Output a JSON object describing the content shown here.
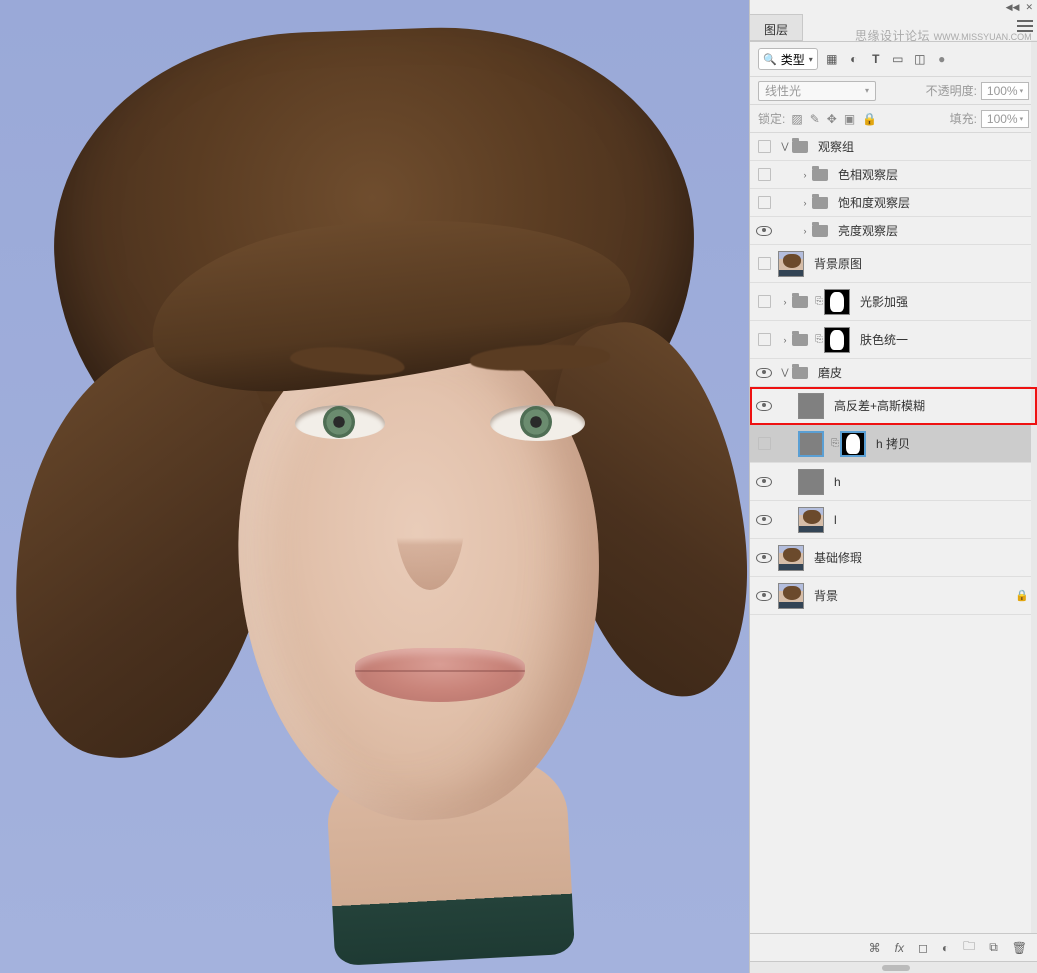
{
  "watermark": {
    "cn": "思缘设计论坛",
    "en": "WWW.MISSYUAN.COM"
  },
  "panelTop": {
    "collapse": "◀◀",
    "close": "✕"
  },
  "tabs": {
    "layers": "图层"
  },
  "filter": {
    "typeLabel": "类型"
  },
  "blend": {
    "mode": "线性光",
    "opacityLabel": "不透明度:",
    "opacityVal": "100%"
  },
  "lock": {
    "label": "锁定:",
    "fillLabel": "填充:",
    "fillVal": "100%"
  },
  "layers": [
    {
      "id": "g-observe",
      "name": "观察组"
    },
    {
      "id": "g-hue",
      "name": "色相观察层"
    },
    {
      "id": "g-sat",
      "name": "饱和度观察层"
    },
    {
      "id": "g-lum",
      "name": "亮度观察层"
    },
    {
      "id": "bg-orig",
      "name": "背景原图"
    },
    {
      "id": "g-light",
      "name": "光影加强"
    },
    {
      "id": "g-skin",
      "name": "肤色统一"
    },
    {
      "id": "g-smooth",
      "name": "磨皮"
    },
    {
      "id": "hipass",
      "name": "高反差+高斯模糊"
    },
    {
      "id": "hcopy",
      "name": "h 拷贝"
    },
    {
      "id": "h",
      "name": "h"
    },
    {
      "id": "l",
      "name": "l"
    },
    {
      "id": "fix",
      "name": "基础修瑕"
    },
    {
      "id": "bg",
      "name": "背景"
    }
  ],
  "icons": {
    "image": "image-type",
    "adjust": "adjustment",
    "text": "T",
    "shape": "shape",
    "smart": "smart-obj",
    "color": "color-filter",
    "link": "link",
    "fx": "fx",
    "mask": "mask",
    "fill": "fill-adj",
    "group": "group",
    "new": "new-layer",
    "trash": "trash"
  }
}
